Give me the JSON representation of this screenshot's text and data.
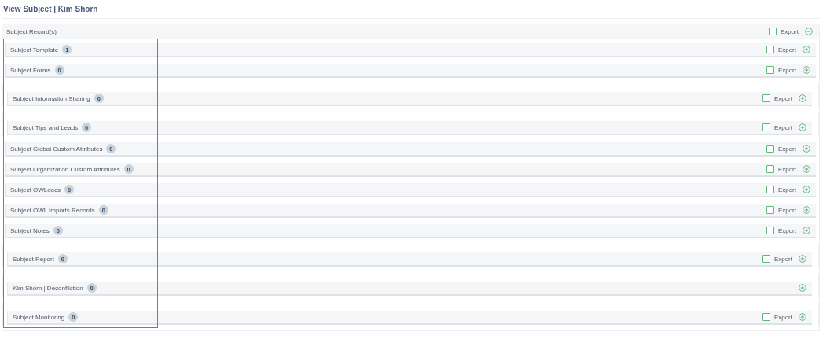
{
  "title": "View Subject | Kim Shorn",
  "record_panel": {
    "label": "Subject Record(s)",
    "export": {
      "label": "Export",
      "checked": false
    },
    "expanded": true
  },
  "sections": [
    {
      "kind": "plain",
      "label": "Subject Template",
      "count": "1",
      "export": {
        "label": "Export",
        "checked": false
      },
      "expanded": false
    },
    {
      "kind": "plain",
      "label": "Subject Forms",
      "count": "0",
      "export": {
        "label": "Export",
        "checked": false
      },
      "expanded": false
    },
    {
      "kind": "wrapped",
      "label": "Subject Information Sharing",
      "count": "0",
      "export": {
        "label": "Export",
        "checked": false
      },
      "expanded": false
    },
    {
      "kind": "wrapped",
      "label": "Subject Tips and Leads",
      "count": "0",
      "export": {
        "label": "Export",
        "checked": false
      },
      "expanded": false
    },
    {
      "kind": "plain",
      "label": "Subject Global Custom Attributes",
      "count": "0",
      "export": {
        "label": "Export",
        "checked": false
      },
      "expanded": false
    },
    {
      "kind": "plain",
      "label": "Subject Organization Custom Attributes",
      "count": "0",
      "export": {
        "label": "Export",
        "checked": false
      },
      "expanded": false
    },
    {
      "kind": "plain",
      "label": "Subject OWLdocs",
      "count": "0",
      "export": {
        "label": "Export",
        "checked": false
      },
      "expanded": false
    },
    {
      "kind": "plain",
      "label": "Subject OWL Imports Records",
      "count": "0",
      "export": {
        "label": "Export",
        "checked": false
      },
      "expanded": false
    },
    {
      "kind": "plain",
      "label": "Subject Notes",
      "count": "0",
      "export": {
        "label": "Export",
        "checked": false
      },
      "expanded": false
    },
    {
      "kind": "wrapped",
      "label": "Subject Report",
      "count": "0",
      "export": {
        "label": "Export",
        "checked": false
      },
      "expanded": false
    },
    {
      "kind": "wrapped",
      "label": "Kim Shorn | Deconfliction",
      "count": "0",
      "expanded": false
    },
    {
      "kind": "wrapped",
      "label": "Subject Monitoring",
      "count": "0",
      "export": {
        "label": "Export",
        "checked": false
      },
      "expanded": false
    }
  ]
}
